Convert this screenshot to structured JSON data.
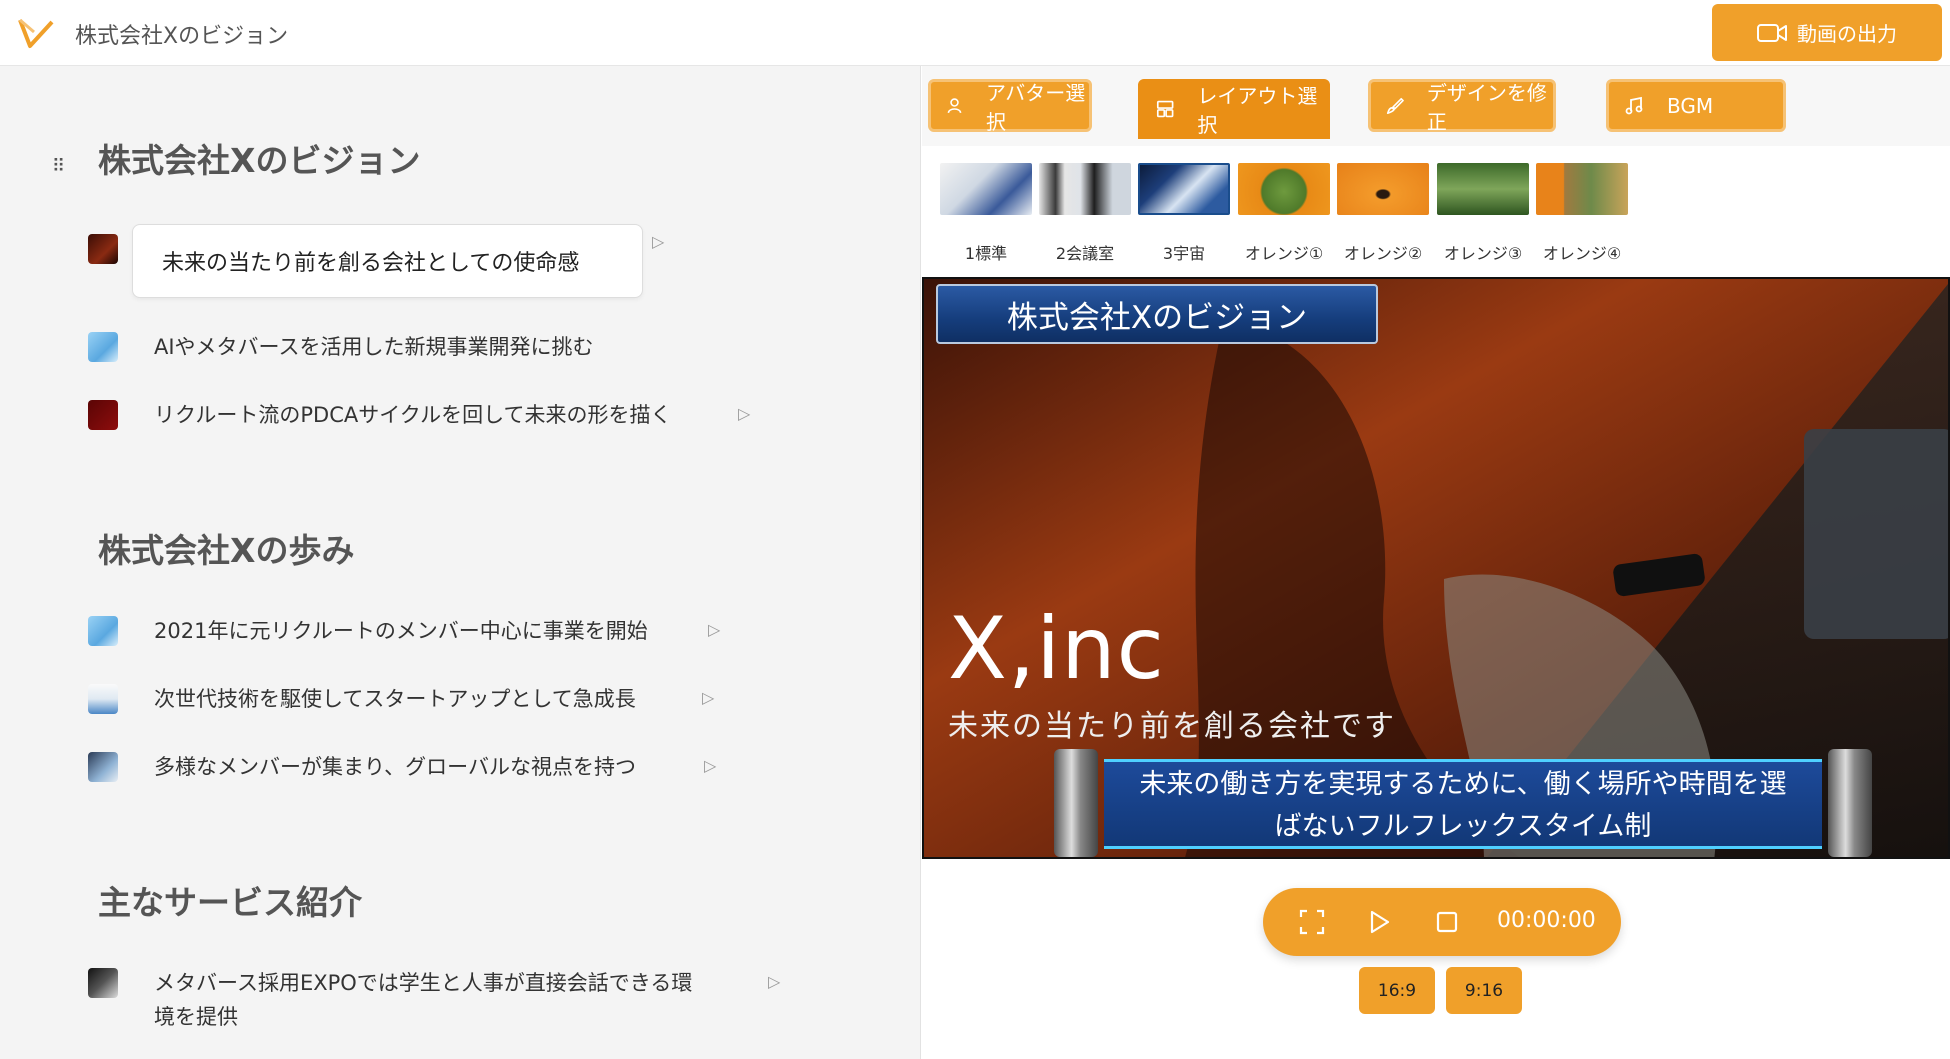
{
  "header": {
    "title": "株式会社Xのビジョン",
    "export_label": "動画の出力",
    "accent": "#f0a02a"
  },
  "left": {
    "sections": [
      {
        "title": "株式会社Xのビジョン",
        "items": [
          {
            "text": "未来の当たり前を創る会社としての使命感"
          },
          {
            "text": "AIやメタバースを活用した新規事業開発に挑む"
          },
          {
            "text": "リクルート流のPDCAサイクルを回して未来の形を描く"
          }
        ]
      },
      {
        "title": "株式会社Xの歩み",
        "items": [
          {
            "text": "2021年に元リクルートのメンバー中心に事業を開始"
          },
          {
            "text": "次世代技術を駆使してスタートアップとして急成長"
          },
          {
            "text": "多様なメンバーが集まり、グローバルな視点を持つ"
          }
        ]
      },
      {
        "title": "主なサービス紹介",
        "items": [
          {
            "text_line1": "メタバース採用EXPOでは学生と人事が直接会話できる環",
            "text_line2": "境を提供"
          }
        ]
      }
    ]
  },
  "tabs": [
    {
      "label": "アバター選択",
      "icon": "user-icon"
    },
    {
      "label": "レイアウト選択",
      "icon": "layout-icon"
    },
    {
      "label": "デザインを修正",
      "icon": "brush-icon"
    },
    {
      "label": "BGM",
      "icon": "music-icon"
    }
  ],
  "layouts": [
    {
      "label": "1標準"
    },
    {
      "label": "2会議室"
    },
    {
      "label": "3宇宙"
    },
    {
      "label": "オレンジ①"
    },
    {
      "label": "オレンジ②"
    },
    {
      "label": "オレンジ③"
    },
    {
      "label": "オレンジ④"
    }
  ],
  "preview": {
    "title": "株式会社Xのビジョン",
    "brand": "X,inc",
    "tagline": "未来の当たり前を創る会社です",
    "caption_line1": "未来の働き方を実現するために、働く場所や時間を選",
    "caption_line2": "ばないフルフレックスタイム制"
  },
  "player": {
    "time": "00:00:00",
    "ratio_a": "16:9",
    "ratio_b": "9:16"
  }
}
